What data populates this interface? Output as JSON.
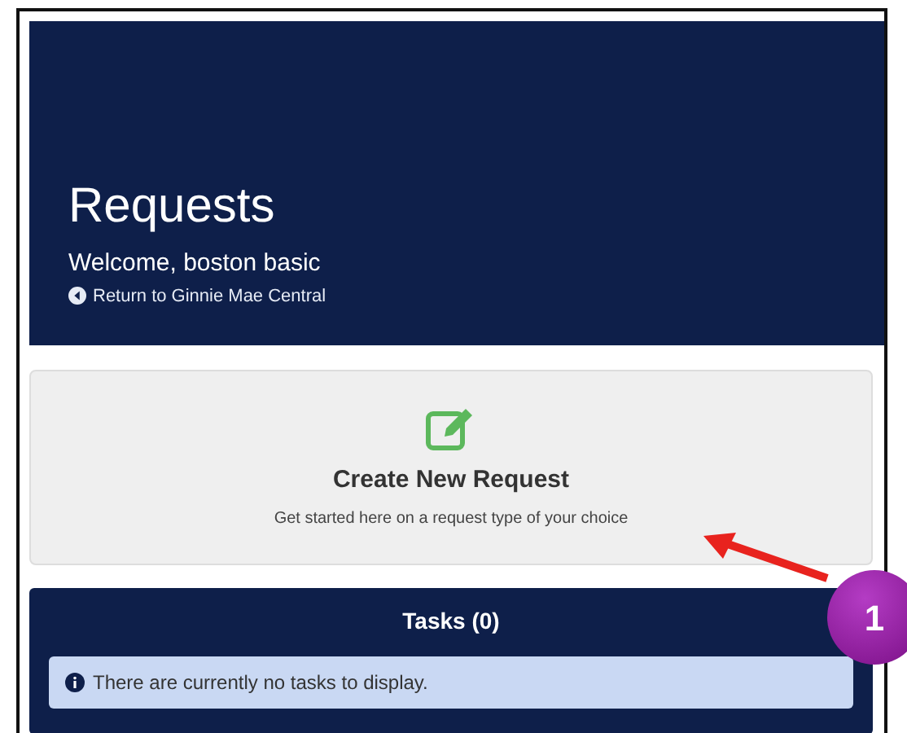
{
  "header": {
    "title": "Requests",
    "welcome": "Welcome, boston basic",
    "return_link": "Return to Ginnie Mae Central"
  },
  "create_card": {
    "title": "Create New Request",
    "subtitle": "Get started here on a request type of your choice"
  },
  "tasks": {
    "title": "Tasks (0)",
    "message": "There are currently no tasks to display."
  },
  "callout": {
    "number": "1"
  }
}
